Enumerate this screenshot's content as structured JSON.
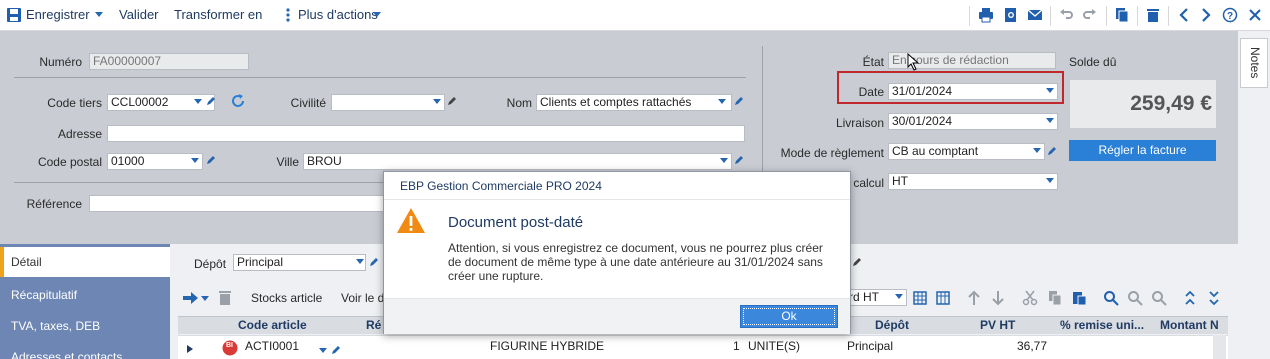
{
  "toolbar": {
    "save_label": "Enregistrer",
    "validate_label": "Valider",
    "transform_label": "Transformer en",
    "more_actions_label": "Plus d'actions"
  },
  "header": {
    "numero_label": "Numéro",
    "numero_value": "FA00000007",
    "etat_label": "État",
    "etat_value": "En cours de rédaction",
    "solde_label": "Solde dû",
    "solde_value": "259,49 €",
    "code_tiers_label": "Code tiers",
    "code_tiers_value": "CCL00002",
    "civilite_label": "Civilité",
    "civilite_value": "",
    "nom_label": "Nom",
    "nom_value": "Clients et comptes rattachés",
    "date_label": "Date",
    "date_value": "31/01/2024",
    "adresse_label": "Adresse",
    "adresse_value": "",
    "livraison_label": "Livraison",
    "livraison_value": "30/01/2024",
    "code_postal_label": "Code postal",
    "code_postal_value": "01000",
    "ville_label": "Ville",
    "ville_value": "BROU",
    "mode_reglement_label": "Mode de règlement",
    "mode_reglement_value": "CB au comptant",
    "regler_button_label": "Régler la facture",
    "reference_label": "Référence",
    "reference_value": "",
    "calcul_label": "calcul",
    "calcul_value": "HT"
  },
  "notes_tab_label": "Notes",
  "tabs": [
    {
      "label": "Détail"
    },
    {
      "label": "Récapitulatif"
    },
    {
      "label": "TVA, taxes, DEB"
    },
    {
      "label": "Adresses et contacts"
    }
  ],
  "detail": {
    "depot_label": "Dépôt",
    "depot_value": "Principal",
    "stocks_article_label": "Stocks article",
    "voir_label": "Voir le d",
    "pricing_mode": "rd HT"
  },
  "grid": {
    "headers": [
      "Code article",
      "Ré",
      "Dépôt",
      "PV HT",
      "% remise uni...",
      "Montant N"
    ],
    "row": {
      "badge": "BI",
      "code_article": "ACTI0001",
      "designation": "FIGURINE HYBRIDE",
      "quantite": "1",
      "unite": "UNITE(S)",
      "depot": "Principal",
      "pv_ht": "36,77"
    }
  },
  "dialog": {
    "title": "EBP Gestion Commerciale PRO 2024",
    "heading": "Document post-daté",
    "message": "Attention, si vous enregistrez ce document, vous ne pourrez plus créer de document de même type à une date antérieure au 31/01/2024 sans créer une rupture.",
    "ok_label": "Ok"
  },
  "colors": {
    "accent": "#2a7fd6",
    "highlight": "#c0282d",
    "warning": "#f0a21a",
    "tab_bg": "#6d86b4"
  }
}
